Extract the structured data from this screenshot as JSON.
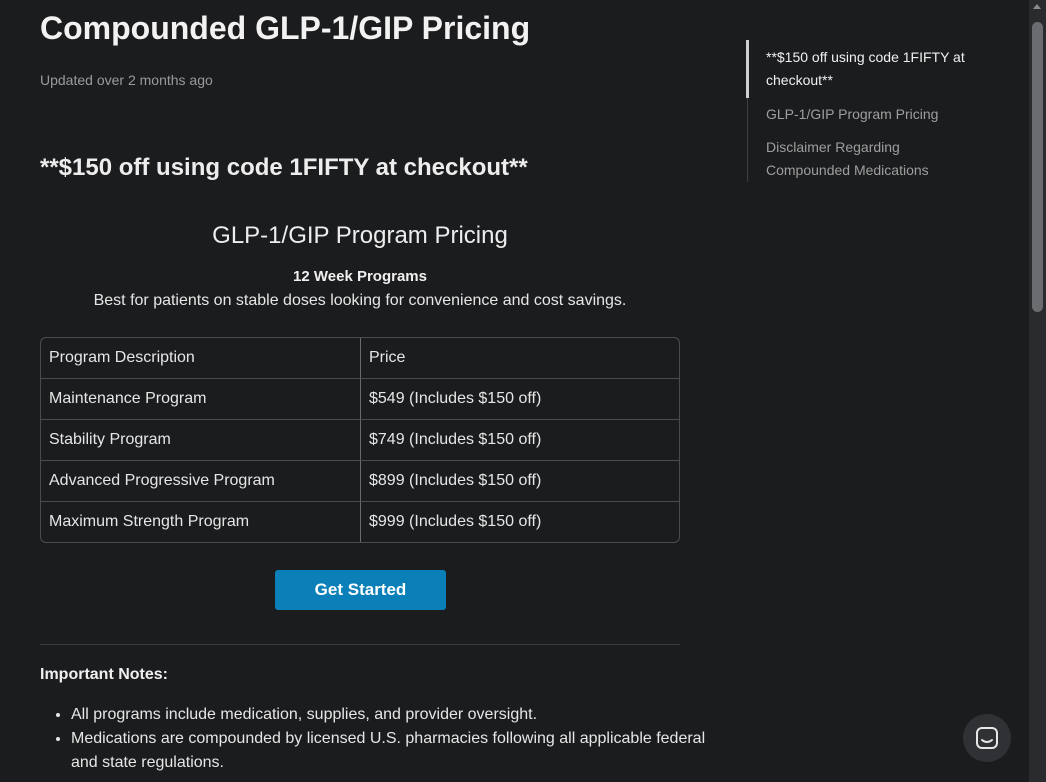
{
  "article": {
    "title": "Compounded GLP-1/GIP Pricing",
    "updated": "Updated over 2 months ago",
    "promo": "**$150 off using code 1FIFTY at checkout**",
    "section_title": "GLP-1/GIP Program Pricing",
    "subheading": "12 Week Programs",
    "description": "Best for patients on stable doses looking for convenience and cost savings."
  },
  "pricing_table": {
    "headers": [
      "Program Description",
      "Price"
    ],
    "rows": [
      [
        "Maintenance Program",
        "$549 (Includes $150 off)"
      ],
      [
        "Stability Program",
        "$749 (Includes $150 off)"
      ],
      [
        "Advanced Progressive Program",
        "$899 (Includes $150 off)"
      ],
      [
        "Maximum Strength Program",
        "$999 (Includes $150 off)"
      ]
    ]
  },
  "cta": {
    "label": "Get Started",
    "color": "#0a7fb8"
  },
  "notes": {
    "title": "Important Notes:",
    "items": [
      "All programs include medication, supplies, and provider oversight.",
      "Medications are compounded by licensed U.S. pharmacies following all applicable federal and state regulations."
    ]
  },
  "toc": {
    "items": [
      {
        "label": "**$150 off using code 1FIFTY at checkout**",
        "active": true
      },
      {
        "label": "GLP-1/GIP Program Pricing",
        "active": false
      },
      {
        "label": "Disclaimer Regarding Compounded Medications",
        "active": false
      }
    ]
  },
  "icons": {
    "chat": "chat-bubble-icon",
    "scroll_up": "scroll-up-arrow-icon"
  },
  "colors": {
    "background": "#1b1c1e",
    "accent": "#0a7fb8"
  }
}
